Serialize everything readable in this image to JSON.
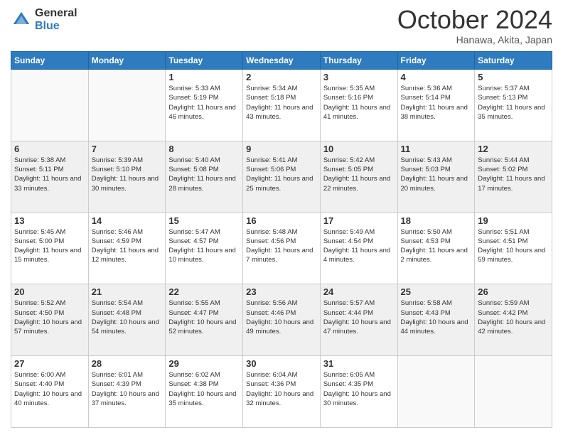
{
  "logo": {
    "general": "General",
    "blue": "Blue"
  },
  "header": {
    "month": "October 2024",
    "location": "Hanawa, Akita, Japan"
  },
  "days": [
    "Sunday",
    "Monday",
    "Tuesday",
    "Wednesday",
    "Thursday",
    "Friday",
    "Saturday"
  ],
  "weeks": [
    [
      {
        "day": "",
        "info": ""
      },
      {
        "day": "",
        "info": ""
      },
      {
        "day": "1",
        "info": "Sunrise: 5:33 AM\nSunset: 5:19 PM\nDaylight: 11 hours and 46 minutes."
      },
      {
        "day": "2",
        "info": "Sunrise: 5:34 AM\nSunset: 5:18 PM\nDaylight: 11 hours and 43 minutes."
      },
      {
        "day": "3",
        "info": "Sunrise: 5:35 AM\nSunset: 5:16 PM\nDaylight: 11 hours and 41 minutes."
      },
      {
        "day": "4",
        "info": "Sunrise: 5:36 AM\nSunset: 5:14 PM\nDaylight: 11 hours and 38 minutes."
      },
      {
        "day": "5",
        "info": "Sunrise: 5:37 AM\nSunset: 5:13 PM\nDaylight: 11 hours and 35 minutes."
      }
    ],
    [
      {
        "day": "6",
        "info": "Sunrise: 5:38 AM\nSunset: 5:11 PM\nDaylight: 11 hours and 33 minutes."
      },
      {
        "day": "7",
        "info": "Sunrise: 5:39 AM\nSunset: 5:10 PM\nDaylight: 11 hours and 30 minutes."
      },
      {
        "day": "8",
        "info": "Sunrise: 5:40 AM\nSunset: 5:08 PM\nDaylight: 11 hours and 28 minutes."
      },
      {
        "day": "9",
        "info": "Sunrise: 5:41 AM\nSunset: 5:06 PM\nDaylight: 11 hours and 25 minutes."
      },
      {
        "day": "10",
        "info": "Sunrise: 5:42 AM\nSunset: 5:05 PM\nDaylight: 11 hours and 22 minutes."
      },
      {
        "day": "11",
        "info": "Sunrise: 5:43 AM\nSunset: 5:03 PM\nDaylight: 11 hours and 20 minutes."
      },
      {
        "day": "12",
        "info": "Sunrise: 5:44 AM\nSunset: 5:02 PM\nDaylight: 11 hours and 17 minutes."
      }
    ],
    [
      {
        "day": "13",
        "info": "Sunrise: 5:45 AM\nSunset: 5:00 PM\nDaylight: 11 hours and 15 minutes."
      },
      {
        "day": "14",
        "info": "Sunrise: 5:46 AM\nSunset: 4:59 PM\nDaylight: 11 hours and 12 minutes."
      },
      {
        "day": "15",
        "info": "Sunrise: 5:47 AM\nSunset: 4:57 PM\nDaylight: 11 hours and 10 minutes."
      },
      {
        "day": "16",
        "info": "Sunrise: 5:48 AM\nSunset: 4:56 PM\nDaylight: 11 hours and 7 minutes."
      },
      {
        "day": "17",
        "info": "Sunrise: 5:49 AM\nSunset: 4:54 PM\nDaylight: 11 hours and 4 minutes."
      },
      {
        "day": "18",
        "info": "Sunrise: 5:50 AM\nSunset: 4:53 PM\nDaylight: 11 hours and 2 minutes."
      },
      {
        "day": "19",
        "info": "Sunrise: 5:51 AM\nSunset: 4:51 PM\nDaylight: 10 hours and 59 minutes."
      }
    ],
    [
      {
        "day": "20",
        "info": "Sunrise: 5:52 AM\nSunset: 4:50 PM\nDaylight: 10 hours and 57 minutes."
      },
      {
        "day": "21",
        "info": "Sunrise: 5:54 AM\nSunset: 4:48 PM\nDaylight: 10 hours and 54 minutes."
      },
      {
        "day": "22",
        "info": "Sunrise: 5:55 AM\nSunset: 4:47 PM\nDaylight: 10 hours and 52 minutes."
      },
      {
        "day": "23",
        "info": "Sunrise: 5:56 AM\nSunset: 4:46 PM\nDaylight: 10 hours and 49 minutes."
      },
      {
        "day": "24",
        "info": "Sunrise: 5:57 AM\nSunset: 4:44 PM\nDaylight: 10 hours and 47 minutes."
      },
      {
        "day": "25",
        "info": "Sunrise: 5:58 AM\nSunset: 4:43 PM\nDaylight: 10 hours and 44 minutes."
      },
      {
        "day": "26",
        "info": "Sunrise: 5:59 AM\nSunset: 4:42 PM\nDaylight: 10 hours and 42 minutes."
      }
    ],
    [
      {
        "day": "27",
        "info": "Sunrise: 6:00 AM\nSunset: 4:40 PM\nDaylight: 10 hours and 40 minutes."
      },
      {
        "day": "28",
        "info": "Sunrise: 6:01 AM\nSunset: 4:39 PM\nDaylight: 10 hours and 37 minutes."
      },
      {
        "day": "29",
        "info": "Sunrise: 6:02 AM\nSunset: 4:38 PM\nDaylight: 10 hours and 35 minutes."
      },
      {
        "day": "30",
        "info": "Sunrise: 6:04 AM\nSunset: 4:36 PM\nDaylight: 10 hours and 32 minutes."
      },
      {
        "day": "31",
        "info": "Sunrise: 6:05 AM\nSunset: 4:35 PM\nDaylight: 10 hours and 30 minutes."
      },
      {
        "day": "",
        "info": ""
      },
      {
        "day": "",
        "info": ""
      }
    ]
  ]
}
